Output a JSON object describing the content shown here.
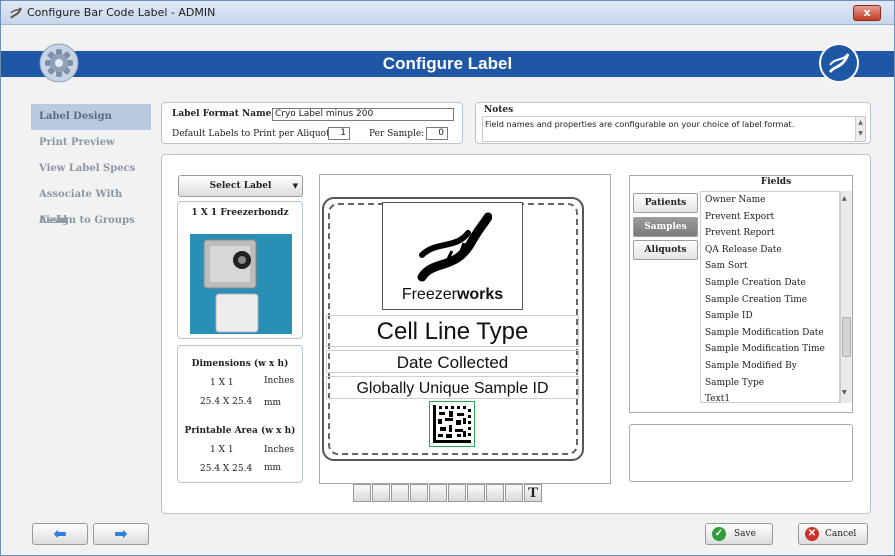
{
  "window": {
    "title": "Configure Bar Code Label - ADMIN",
    "close": "x"
  },
  "header": {
    "title": "Configure Label"
  },
  "sidebar": {
    "items": [
      {
        "label": "Label Design",
        "active": true
      },
      {
        "label": "Print Preview"
      },
      {
        "label": "View Label Specs"
      },
      {
        "label": "Associate With Field"
      },
      {
        "label": "Assign to Groups"
      }
    ]
  },
  "format": {
    "name_label": "Label Format Name:",
    "name_value": "Cryo Label minus 200",
    "default_label": "Default Labels to Print per Aliquot:",
    "default_value": "1",
    "per_sample_label": "Per Sample:",
    "per_sample_value": "0"
  },
  "notes": {
    "title": "Notes",
    "text": "Field names and properties are configurable on your choice of label format."
  },
  "select_label": {
    "button": "Select Label",
    "label_name": "1 X 1 Freezerbondz"
  },
  "dimensions": {
    "title": "Dimensions (w x h)",
    "inches_value": "1 X 1",
    "inches_unit": "Inches",
    "mm_value": "25.4 X 25.4",
    "mm_unit": "mm"
  },
  "printable": {
    "title": "Printable Area (w x h)",
    "inches_value": "1 X 1",
    "inches_unit": "Inches",
    "mm_value": "25.4 X 25.4",
    "mm_unit": "mm"
  },
  "label_preview": {
    "logo_text_light": "Freezer",
    "logo_text_bold": "works",
    "field1": "Cell Line Type",
    "field2": "Date Collected",
    "field3": "Globally Unique Sample ID"
  },
  "toolbar": {
    "text_tool": "T"
  },
  "fields": {
    "header": "Fields",
    "tabs": [
      "Patients",
      "Samples",
      "Aliquots"
    ],
    "active_tab": "Samples",
    "items": [
      "Owner Name",
      "Prevent Export",
      "Prevent Report",
      "QA Release Date",
      "Sam Sort",
      "Sample Creation Date",
      "Sample Creation Time",
      "Sample ID",
      "Sample Modification Date",
      "Sample Modification Time",
      "Sample Modified By",
      "Sample Type",
      "Text1"
    ]
  },
  "footer": {
    "save": "Save",
    "cancel": "Cancel"
  },
  "colors": {
    "header_blue": "#1e57a6",
    "sidebar_active": "#b8cbe0",
    "arrow_blue": "#2f7fe0"
  }
}
